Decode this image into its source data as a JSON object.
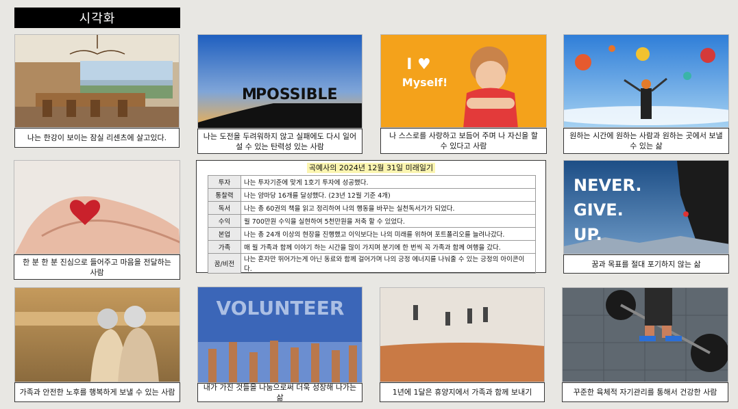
{
  "title": "시각화",
  "cards": [
    {
      "caption": "나는 한강이 보이는 잠실 리센츠에 살고있다."
    },
    {
      "caption": "나는 도전을 두려워하지 않고 실패에도 다시 일어설 수 있는 탄력성 있는 사람",
      "img_text": "POSSIBLE",
      "img_text_prefix": "M"
    },
    {
      "caption": "나 스스로를 사랑하고 보듬어 주며 나 자신을 할 수 있다고 사람",
      "img_text_top": "I ♥",
      "img_text": "Myself!"
    },
    {
      "caption": "원하는 시간에 원하는 사람과 원하는 곳에서 보낼 수 있는 삶"
    },
    {
      "caption": "한 분 한 분 진심으로 들어주고 마음을 전달하는 사람"
    },
    {
      "caption": "꿈과 목표를 절대 포기하지 않는 삶",
      "img_lines": [
        "NEVER.",
        "GIVE.",
        "UP."
      ]
    },
    {
      "caption": "가족과 안전한 노후를 행복하게 보낼 수 있는 사람"
    },
    {
      "caption": "내가 가진 것들을 나눔으로써 더욱 성장해 나가는 삶",
      "img_text": "VOLUNTEER"
    },
    {
      "caption": "1년에 1달은 휴양지에서 가족과 함께 보내기"
    },
    {
      "caption": "꾸준한 육체적 자기관리를 통해서 건강한 사람"
    }
  ],
  "diary": {
    "title": "곡예사의 2024년 12월 31일 미래일기",
    "rows": [
      {
        "k": "투자",
        "v": "나는 투자기준에 맞게 1호기 투자에 성공했다."
      },
      {
        "k": "통찰력",
        "v": "나는 얌마당 16개를 달성했다. (23년 12월 기준 4개)"
      },
      {
        "k": "독서",
        "v": "나는 총 60권의 책을 읽고 정리하여 나의 행동을 바꾸는 실천독서가가 되었다."
      },
      {
        "k": "수익",
        "v": "월 700만원 수익을 실현하여 5천만원을 저축 할 수 있었다."
      },
      {
        "k": "본업",
        "v": "나는 총 24개 이상의 현장을 진행했고 이익보다는 나의 미래를 위하여 포트폴리오를 늘려나갔다."
      },
      {
        "k": "가족",
        "v": "매 월 가족과 함께 이야기 하는 시간을 많이 가지며 분기에 한 번씩 꼭 가족과 함께 여행을 갔다."
      },
      {
        "k": "꿈/비전",
        "v": "나는 혼자만 뛰어가는게 아닌 동료와 함께 걸어가며 나의 긍정 에너지를 나눠줄 수 있는 긍정의 아이콘이다."
      }
    ]
  }
}
